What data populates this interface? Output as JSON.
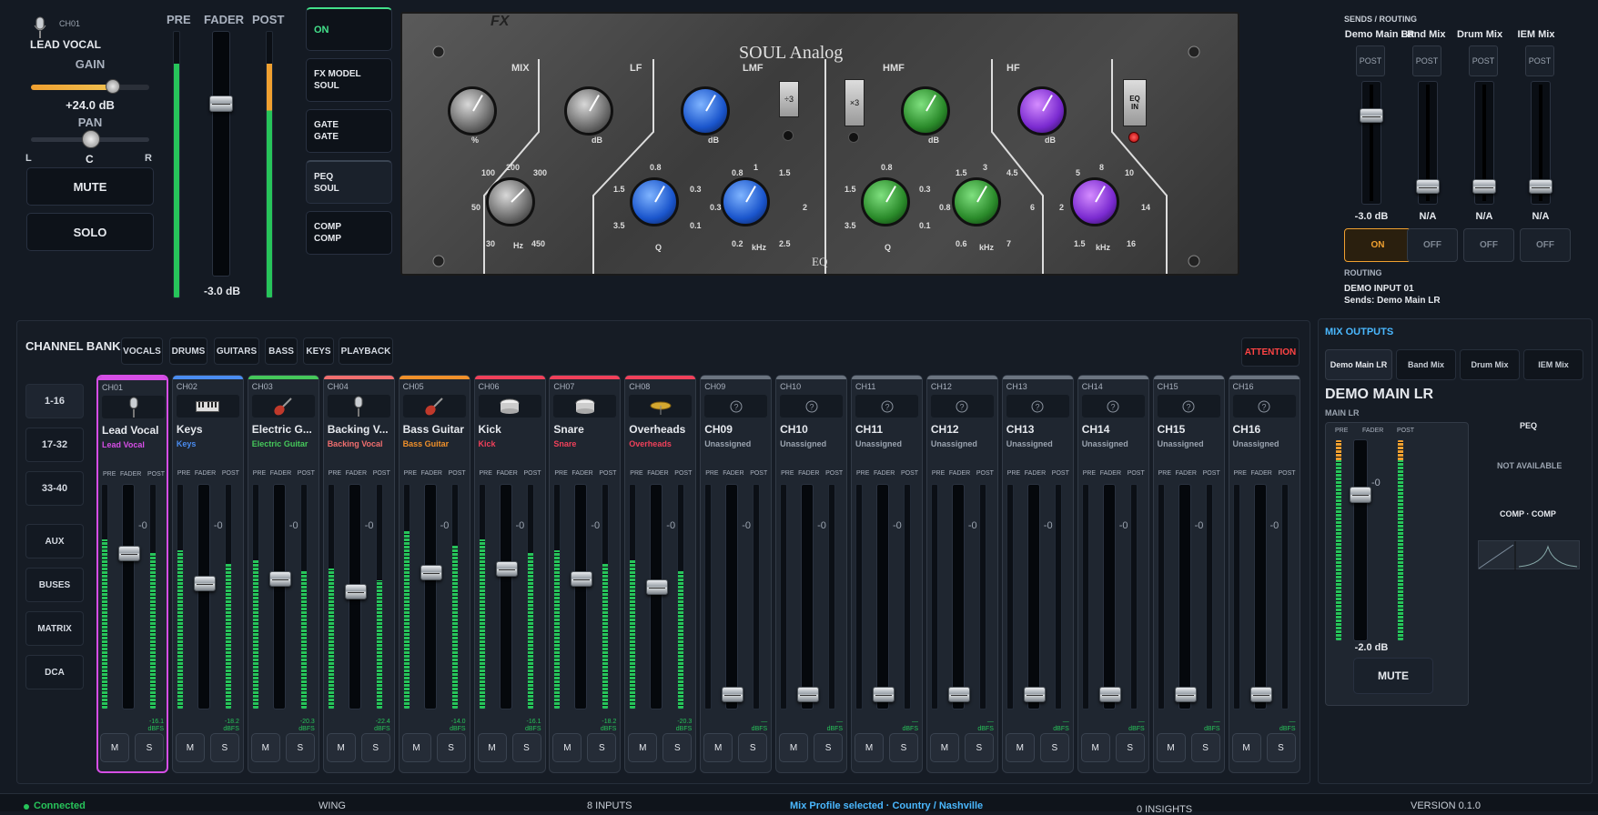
{
  "selected_channel": {
    "id": "CH01",
    "name": "LEAD VOCAL",
    "gain_label": "GAIN",
    "gain_value": "+24.0 dB",
    "gain_level": 1.0,
    "pan_label": "PAN",
    "pan_l": "L",
    "pan_c": "C",
    "pan_r": "R",
    "mute_label": "MUTE",
    "solo_label": "SOLO",
    "pre_label": "PRE",
    "fader_label": "FADER",
    "post_label": "POST",
    "fader_value": "-3.0 dB",
    "pre_level": 0.88,
    "post_level": 0.88
  },
  "fx_buttons": [
    {
      "label": "ON"
    },
    {
      "label": "FX MODEL",
      "sub": "SOUL"
    },
    {
      "label": "GATE",
      "sub": "GATE"
    },
    {
      "label": "PEQ",
      "sub": "SOUL"
    },
    {
      "label": "COMP",
      "sub": "COMP"
    }
  ],
  "eq_panel": {
    "title": "SOUL Analog",
    "footer": "EQ",
    "fx_logo": "FX",
    "sections": [
      {
        "label": "MIX"
      },
      {
        "label": "LF"
      },
      {
        "label": "LMF"
      },
      {
        "label": "HMF"
      },
      {
        "label": "HF"
      }
    ],
    "div3": "÷3",
    "mul3": "×3",
    "eqin": "EQ IN",
    "lf_freqs": [
      "100",
      "200",
      "300",
      "50",
      "30",
      "Hz",
      "450"
    ],
    "lmf_q": [
      "0.8",
      "1.5",
      "0.3",
      "3.5",
      "Q",
      "0.1"
    ],
    "lmf_freq": [
      "0.8",
      "1",
      "1.5",
      "0.3",
      "2",
      "0.2",
      "kHz",
      "2.5"
    ],
    "hmf_q": [
      "0.8",
      "1.5",
      "0.3",
      "3.5",
      "Q",
      "0.1"
    ],
    "hmf_freq": [
      "1.5",
      "3",
      "4.5",
      "0.8",
      "6",
      "0.6",
      "kHz",
      "7"
    ],
    "hf_freq": [
      "5",
      "8",
      "10",
      "2",
      "14",
      "1.5",
      "kHz",
      "16"
    ],
    "pct": "%",
    "db": "dB"
  },
  "sends": {
    "title": "SENDS / ROUTING",
    "items": [
      {
        "name": "Demo Main LR",
        "tap": "POST",
        "value": "-3.0 dB",
        "state": "ON",
        "level": 0.75
      },
      {
        "name": "Band Mix",
        "tap": "POST",
        "value": "N/A",
        "state": "OFF",
        "level": 0.1
      },
      {
        "name": "Drum Mix",
        "tap": "POST",
        "value": "N/A",
        "state": "OFF",
        "level": 0.1
      },
      {
        "name": "IEM Mix",
        "tap": "POST",
        "value": "N/A",
        "state": "OFF",
        "level": 0.1
      }
    ],
    "routing_title": "ROUTING",
    "routing_input": "DEMO INPUT 01",
    "routing_sends": "Sends: Demo Main LR"
  },
  "bank": {
    "title": "CHANNEL BANK",
    "tabs": [
      "VOCALS",
      "DRUMS",
      "GUITARS",
      "BASS",
      "KEYS",
      "PLAYBACK"
    ],
    "attention": "ATTENTION",
    "nav": [
      "1-16",
      "17-32",
      "33-40",
      "AUX",
      "BUSES",
      "MATRIX",
      "DCA"
    ],
    "zero": "-0",
    "pre": "PRE",
    "fader": "FADER",
    "post": "POST",
    "m": "M",
    "s": "S"
  },
  "channels": [
    {
      "id": "CH01",
      "name": "Lead Vocal",
      "sub": "Lead Vocal",
      "color": "#d64ee6",
      "icon": "mic",
      "read": "-16.1 dBFS",
      "level": 0.75,
      "fader": 0.72
    },
    {
      "id": "CH02",
      "name": "Keys",
      "sub": "Keys",
      "color": "#4a8cf0",
      "icon": "keys",
      "read": "-18.2 dBFS",
      "level": 0.7,
      "fader": 0.58
    },
    {
      "id": "CH03",
      "name": "Electric G...",
      "sub": "Electric Guitar",
      "color": "#45c85a",
      "icon": "guitar",
      "read": "-20.3 dBFS",
      "level": 0.66,
      "fader": 0.6
    },
    {
      "id": "CH04",
      "name": "Backing V...",
      "sub": "Backing Vocal",
      "color": "#f06e6e",
      "icon": "mic",
      "read": "-22.4 dBFS",
      "level": 0.62,
      "fader": 0.54
    },
    {
      "id": "CH05",
      "name": "Bass Guitar",
      "sub": "Bass Guitar",
      "color": "#f0902a",
      "icon": "guitar",
      "read": "-14.0 dBFS",
      "level": 0.79,
      "fader": 0.63
    },
    {
      "id": "CH06",
      "name": "Kick",
      "sub": "Kick",
      "color": "#f0405a",
      "icon": "drum",
      "read": "-16.1 dBFS",
      "level": 0.75,
      "fader": 0.65
    },
    {
      "id": "CH07",
      "name": "Snare",
      "sub": "Snare",
      "color": "#f0405a",
      "icon": "drum",
      "read": "-18.2 dBFS",
      "level": 0.7,
      "fader": 0.6
    },
    {
      "id": "CH08",
      "name": "Overheads",
      "sub": "Overheads",
      "color": "#f0405a",
      "icon": "cymbal",
      "read": "-20.3 dBFS",
      "level": 0.66,
      "fader": 0.56
    },
    {
      "id": "CH09",
      "name": "CH09",
      "sub": "Unassigned",
      "color": "#6b7480",
      "icon": "q",
      "read": "— dBFS",
      "level": 0,
      "fader": 0.05
    },
    {
      "id": "CH10",
      "name": "CH10",
      "sub": "Unassigned",
      "color": "#6b7480",
      "icon": "q",
      "read": "— dBFS",
      "level": 0,
      "fader": 0.05
    },
    {
      "id": "CH11",
      "name": "CH11",
      "sub": "Unassigned",
      "color": "#6b7480",
      "icon": "q",
      "read": "— dBFS",
      "level": 0,
      "fader": 0.05
    },
    {
      "id": "CH12",
      "name": "CH12",
      "sub": "Unassigned",
      "color": "#6b7480",
      "icon": "q",
      "read": "— dBFS",
      "level": 0,
      "fader": 0.05
    },
    {
      "id": "CH13",
      "name": "CH13",
      "sub": "Unassigned",
      "color": "#6b7480",
      "icon": "q",
      "read": "— dBFS",
      "level": 0,
      "fader": 0.05
    },
    {
      "id": "CH14",
      "name": "CH14",
      "sub": "Unassigned",
      "color": "#6b7480",
      "icon": "q",
      "read": "— dBFS",
      "level": 0,
      "fader": 0.05
    },
    {
      "id": "CH15",
      "name": "CH15",
      "sub": "Unassigned",
      "color": "#6b7480",
      "icon": "q",
      "read": "— dBFS",
      "level": 0,
      "fader": 0.05
    },
    {
      "id": "CH16",
      "name": "CH16",
      "sub": "Unassigned",
      "color": "#6b7480",
      "icon": "q",
      "read": "— dBFS",
      "level": 0,
      "fader": 0.05
    }
  ],
  "mix_outputs": {
    "title": "MIX OUTPUTS",
    "tabs": [
      "Demo Main LR",
      "Band Mix",
      "Drum Mix",
      "IEM Mix"
    ],
    "name": "DEMO MAIN LR",
    "sub": "MAIN LR",
    "pre": "PRE",
    "fader": "FADER",
    "post": "POST",
    "zero": "-0",
    "value": "-2.0 dB",
    "mute": "MUTE",
    "peq": "PEQ",
    "not_available": "NOT AVAILABLE",
    "comp": "COMP · COMP",
    "level": 0.93,
    "fader_pos": 0.72
  },
  "status": {
    "connected": "Connected",
    "device": "WING",
    "inputs": "8 INPUTS",
    "profile": "Mix Profile selected · Country / Nashville",
    "insights": "0 INSIGHTS",
    "version": "VERSION 0.1.0"
  }
}
